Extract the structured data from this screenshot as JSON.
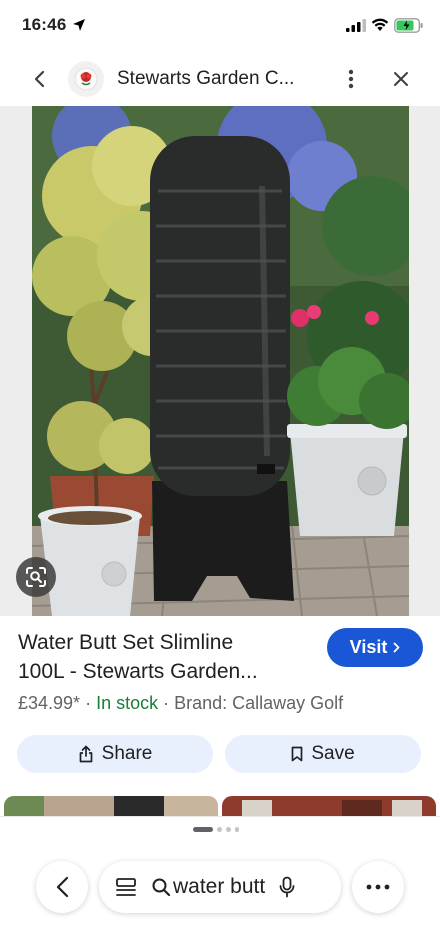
{
  "status_bar": {
    "time": "16:46"
  },
  "header": {
    "title": "Stewarts Garden C..."
  },
  "product": {
    "title_line1": "Water Butt Set Slimline",
    "title_line2": "100L - Stewarts Garden...",
    "price": "£34.99*",
    "availability": "In stock",
    "brand": "Brand: Callaway Golf",
    "visit_label": "Visit"
  },
  "actions": {
    "share_label": "Share",
    "save_label": "Save"
  },
  "search": {
    "query": "water butt"
  },
  "colors": {
    "accent": "#1a57d6",
    "in_stock": "#188038",
    "action_bg": "#e8f0fe"
  },
  "icons": [
    "location-arrow-icon",
    "signal-icon",
    "wifi-icon",
    "battery-icon",
    "back-arrow-icon",
    "site-logo-icon",
    "more-vertical-icon",
    "close-icon",
    "lens-icon",
    "share-icon",
    "bookmark-icon",
    "list-icon",
    "search-icon",
    "mic-icon",
    "more-horizontal-icon"
  ]
}
